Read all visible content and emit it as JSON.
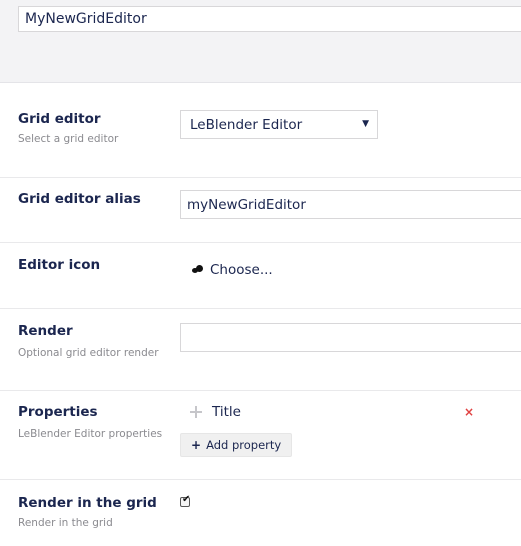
{
  "editor_name": {
    "value": "MyNewGridEditor"
  },
  "grid_editor": {
    "label": "Grid editor",
    "description": "Select a grid editor",
    "selected": "LeBlender Editor",
    "caret": "▼"
  },
  "alias": {
    "label": "Grid editor alias",
    "value": "myNewGridEditor"
  },
  "editor_icon": {
    "label": "Editor icon",
    "choose_label": "Choose..."
  },
  "render": {
    "label": "Render",
    "description": "Optional grid editor render",
    "value": ""
  },
  "properties": {
    "label": "Properties",
    "description": "LeBlender Editor properties",
    "items": [
      {
        "title": "Title",
        "remove_symbol": "×"
      }
    ],
    "add_label": "Add property",
    "add_symbol": "+"
  },
  "render_in_grid": {
    "label": "Render in the grid",
    "description": "Render in the grid",
    "checked": true,
    "check_symbol": "✔"
  },
  "colors": {
    "text": "#1b264f",
    "description": "#8a8a8f",
    "remove": "#e04141",
    "top_band": "#f3f3f5"
  }
}
